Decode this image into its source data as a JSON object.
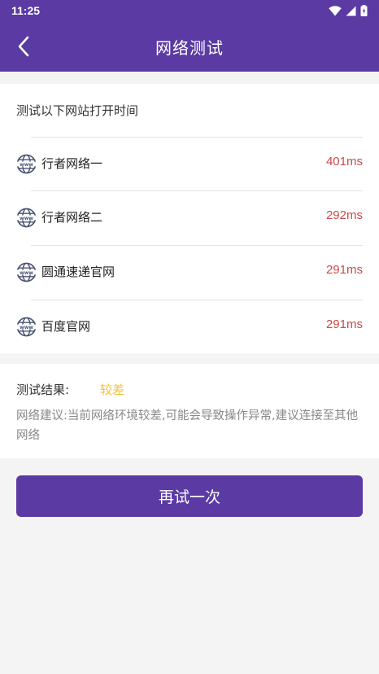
{
  "status_bar": {
    "time": "11:25",
    "icons": [
      "wifi-icon",
      "signal-icon",
      "battery-icon"
    ]
  },
  "app_bar": {
    "title": "网络测试",
    "back_icon": "back-arrow-icon"
  },
  "test_list": {
    "header": "测试以下网站打开时间",
    "items": [
      {
        "name": "行者网络一",
        "latency": "401ms",
        "icon": "globe-www-icon"
      },
      {
        "name": "行者网络二",
        "latency": "292ms",
        "icon": "globe-www-icon"
      },
      {
        "name": "圆通速递官网",
        "latency": "291ms",
        "icon": "globe-www-icon"
      },
      {
        "name": "百度官网",
        "latency": "291ms",
        "icon": "globe-www-icon"
      }
    ]
  },
  "result": {
    "label": "测试结果:",
    "value": "较差",
    "advice": "网络建议:当前网络环境较差,可能会导致操作异常,建议连接至其他网络"
  },
  "actions": {
    "retry_label": "再试一次"
  },
  "colors": {
    "primary": "#5b3aa3",
    "latency_text": "#c94a4a",
    "result_value": "#f0c23a",
    "background": "#f4f4f4",
    "icon": "#4a5573"
  }
}
